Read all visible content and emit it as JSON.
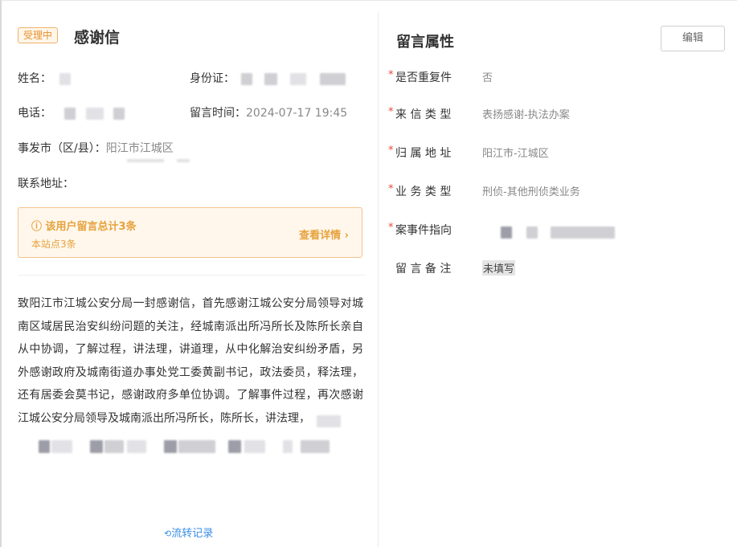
{
  "status_badge": "受理中",
  "title": "感谢信",
  "fields": {
    "name_label": "姓名：",
    "id_label": "身份证：",
    "phone_label": "电话：",
    "time_label": "留言时间：",
    "time_value": "2024-07-17 19:45",
    "district_label": "事发市（区/县）：",
    "district_value": "阳江市江城区",
    "address_label": "联系地址："
  },
  "notice": {
    "title": "ⓘ 该用户留言总计3条",
    "subtitle": "本站点3条",
    "link": "查看详情 ›"
  },
  "content": "致阳江市江城公安分局一封感谢信，首先感谢江城公安分局领导对城南区域居民治安纠纷问题的关注，经城南派出所冯所长及陈所长亲自从中协调，了解过程，讲法理，讲道理，从中化解治安纠纷矛盾，另外感谢政府及城南街道办事处党工委黄副书记，政法委员，释法理，还有居委会莫书记，感谢政府多单位协调。了解事件过程，再次感谢江城公安分局领导及城南派出所冯所长，陈所长，讲法理，",
  "history_link": "流转记录",
  "attributes": {
    "title": "留言属性",
    "edit_label": "编辑",
    "rows": [
      {
        "required": "*",
        "label": "是否重复件",
        "value": "否"
      },
      {
        "required": "*",
        "label": "来 信 类 型",
        "value": "表扬感谢-执法办案"
      },
      {
        "required": "*",
        "label": "归 属 地 址",
        "value": "阳江市-江城区"
      },
      {
        "required": "*",
        "label": "业 务 类 型",
        "value": "刑侦-其他刑侦类业务"
      },
      {
        "required": "*",
        "label": "案事件指向",
        "value": ""
      },
      {
        "required": "",
        "label": "留 言 备 注",
        "value": "未填写"
      }
    ]
  },
  "colors": {
    "accent_orange": "#e6a23c",
    "link_blue": "#3a8ee6",
    "required_red": "#e84a3c"
  }
}
